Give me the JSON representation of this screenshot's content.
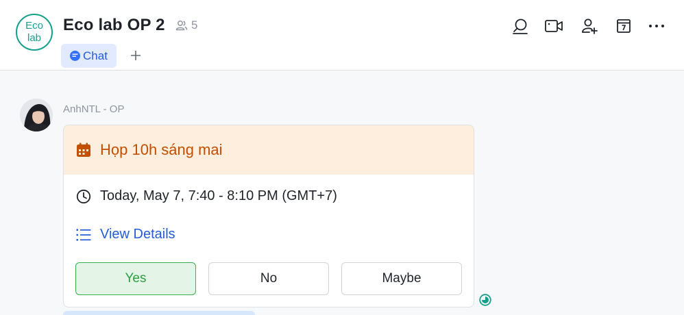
{
  "header": {
    "avatar_line1": "Eco",
    "avatar_line2": "lab",
    "title": "Eco lab OP 2",
    "member_count": "5",
    "tabs": [
      {
        "label": "Chat"
      }
    ],
    "actions": [
      "search-icon",
      "video-call-icon",
      "add-member-icon",
      "calendar-icon",
      "more-icon"
    ]
  },
  "message": {
    "sender": "AnhNTL - OP",
    "event": {
      "title": "Họp 10h sáng mai",
      "time": "Today, May 7, 7:40 - 8:10 PM (GMT+7)",
      "details_link": "View Details",
      "rsvp": {
        "yes": "Yes",
        "no": "No",
        "maybe": "Maybe"
      }
    }
  },
  "colors": {
    "accent_teal": "#14a08c",
    "link_blue": "#245bdb",
    "event_header_bg": "#feeedd",
    "event_title": "#c24e00",
    "yes_green": "#2c9f3f"
  }
}
